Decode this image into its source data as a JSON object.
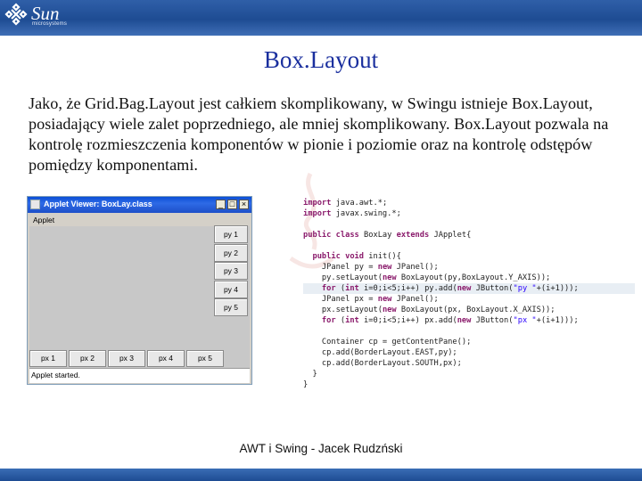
{
  "header": {
    "logo_text": "Sun",
    "logo_subtext": "microsystems"
  },
  "slide": {
    "title": "Box.Layout",
    "body": "Jako, że Grid.Bag.Layout jest całkiem skomplikowany, w Swingu istnieje Box.Layout, posiadający wiele zalet poprzedniego, ale mniej skomplikowany. Box.Layout pozwala na kontrolę rozmieszczenia komponentów w pionie i poziomie oraz na kontrolę odstępów pomiędzy komponentami.",
    "footer": "AWT i Swing - Jacek Rudzński"
  },
  "applet": {
    "title": "Applet Viewer: BoxLay.class",
    "menu": "Applet",
    "window_buttons": [
      "_",
      "□",
      "×"
    ],
    "py_buttons": [
      "py 1",
      "py 2",
      "py 3",
      "py 4",
      "py 5"
    ],
    "px_buttons": [
      "px 1",
      "px 2",
      "px 3",
      "px 4",
      "px 5"
    ],
    "status": "Applet started."
  },
  "code": {
    "lines": [
      "import java.awt.*;",
      "import javax.swing.*;",
      "",
      "public class BoxLay extends JApplet{",
      "",
      "  public void init(){",
      "    JPanel py = new JPanel();",
      "    py.setLayout(new BoxLayout(py,BoxLayout.Y_AXIS));",
      "    for (int i=0;i<5;i++) py.add(new JButton(\"py \"+(i+1)));",
      "    JPanel px = new JPanel();",
      "    px.setLayout(new BoxLayout(px, BoxLayout.X_AXIS));",
      "    for (int i=0;i<5;i++) px.add(new JButton(\"px \"+(i+1)));",
      "",
      "    Container cp = getContentPane();",
      "    cp.add(BorderLayout.EAST,py);",
      "    cp.add(BorderLayout.SOUTH,px);",
      "  }",
      "}"
    ],
    "highlighted_line": 8
  },
  "colors": {
    "title": "#1a2f9e",
    "header_bar": "#1e4c93",
    "keyword": "#8a1a6b",
    "string": "#2a00ff"
  }
}
